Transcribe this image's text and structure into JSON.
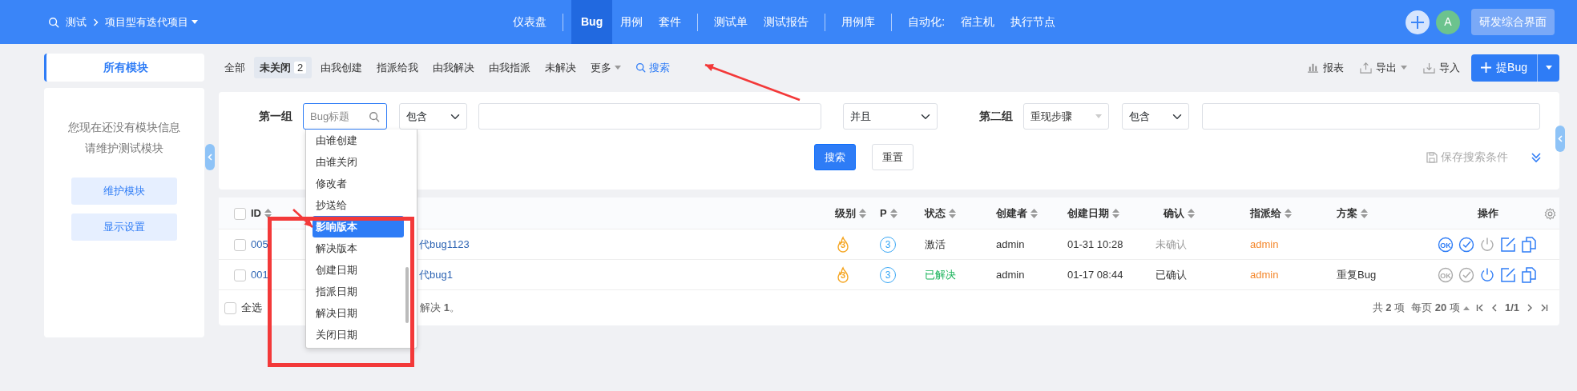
{
  "top_bar": {
    "product": "测试",
    "project": "项目型有迭代项目",
    "nav": [
      [
        {
          "label": "仪表盘",
          "selected": false
        }
      ],
      [
        {
          "label": "Bug",
          "selected": true
        },
        {
          "label": "用例",
          "selected": false
        },
        {
          "label": "套件",
          "selected": false
        }
      ],
      [
        {
          "label": "测试单",
          "selected": false
        },
        {
          "label": "测试报告",
          "selected": false
        }
      ],
      [
        {
          "label": "用例库",
          "selected": false
        }
      ],
      [
        {
          "label": "自动化:",
          "selected": false
        },
        {
          "label": "宿主机",
          "selected": false
        },
        {
          "label": "执行节点",
          "selected": false
        }
      ]
    ],
    "avatar": "A",
    "workspace_button": "研发综合界面"
  },
  "sidebar": {
    "tab": "所有模块",
    "empty_message": [
      "您现在还没有模块信息",
      "请维护测试模块"
    ],
    "buttons": [
      "维护模块",
      "显示设置"
    ]
  },
  "filters": [
    {
      "label": "全部",
      "kind": "tab",
      "selected": false
    },
    {
      "label": "未关闭",
      "count": "2",
      "kind": "tab",
      "selected": true
    },
    {
      "label": "由我创建",
      "kind": "tab",
      "selected": false
    },
    {
      "label": "指派给我",
      "kind": "tab",
      "selected": false
    },
    {
      "label": "由我解决",
      "kind": "tab",
      "selected": false
    },
    {
      "label": "由我指派",
      "kind": "tab",
      "selected": false
    },
    {
      "label": "未解决",
      "kind": "tab",
      "selected": false
    },
    {
      "label": "更多",
      "kind": "menu",
      "selected": false
    },
    {
      "label": "搜索",
      "kind": "search",
      "selected": false
    }
  ],
  "toolbar": [
    {
      "label": "报表",
      "kind": "report"
    },
    {
      "label": "导出",
      "kind": "export"
    },
    {
      "label": "导入",
      "kind": "import"
    }
  ],
  "create_button": "提Bug",
  "search_form": {
    "group_1": {
      "label": "第一组",
      "field_placeholder": "Bug标题",
      "operator": "包含"
    },
    "logic": "并且",
    "group_2": {
      "label": "第二组",
      "field": "重现步骤",
      "operator": "包含"
    },
    "buttons": [
      "搜索",
      "重置"
    ],
    "save_link": "保存搜索条件"
  },
  "field_dropdown": [
    {
      "label": "由谁创建",
      "selected": false
    },
    {
      "label": "由谁关闭",
      "selected": false
    },
    {
      "label": "修改者",
      "selected": false
    },
    {
      "label": "抄送给",
      "selected": false
    },
    {
      "label": "影响版本",
      "selected": true
    },
    {
      "label": "解决版本",
      "selected": false
    },
    {
      "label": "创建日期",
      "selected": false
    },
    {
      "label": "指派日期",
      "selected": false
    },
    {
      "label": "解决日期",
      "selected": false
    },
    {
      "label": "关闭日期",
      "selected": false
    }
  ],
  "table": {
    "header_checked": false,
    "columns": [
      {
        "label": "ID",
        "sortable": true
      },
      {
        "label": "级别",
        "sortable": true
      },
      {
        "label": "P",
        "sortable": true
      },
      {
        "label": "状态",
        "sortable": true
      },
      {
        "label": "创建者",
        "sortable": true
      },
      {
        "label": "创建日期",
        "sortable": true
      },
      {
        "label": "确认",
        "sortable": true
      },
      {
        "label": "指派给",
        "sortable": true
      },
      {
        "label": "方案",
        "sortable": true
      },
      {
        "label": "操作",
        "sortable": false
      }
    ],
    "rows": [
      {
        "checked": false,
        "id": "005",
        "title": "代bug1123",
        "severity": "3",
        "priority": "3",
        "status": {
          "text": "激活",
          "resolved": false
        },
        "creator": "admin",
        "created": "01-31 10:28",
        "confirmation": "未确认",
        "confirmed": false,
        "assigned_to": "admin",
        "actions": [
          {
            "kind": "confirm",
            "label": "OK",
            "disabled": false
          },
          {
            "kind": "resolve",
            "disabled": false
          },
          {
            "kind": "close",
            "disabled": true
          },
          {
            "kind": "edit",
            "disabled": false
          },
          {
            "kind": "copy",
            "disabled": false
          }
        ]
      },
      {
        "checked": false,
        "id": "001",
        "title": "代bug1",
        "severity": "3",
        "priority": "3",
        "status": {
          "text": "已解决",
          "resolved": true
        },
        "creator": "admin",
        "created": "01-17 08:44",
        "confirmation": "已确认",
        "confirmed": true,
        "assigned_to": "admin",
        "resolution": "重复Bug",
        "actions": [
          {
            "kind": "confirm",
            "label": "OK",
            "disabled": true
          },
          {
            "kind": "resolve",
            "disabled": true
          },
          {
            "kind": "close",
            "disabled": false
          },
          {
            "kind": "edit",
            "disabled": false
          },
          {
            "kind": "copy",
            "disabled": false
          }
        ]
      }
    ],
    "footer": {
      "select_all": "全选",
      "select_all_checked": false,
      "summary": "解决 **1**。"
    },
    "pagination": {
      "total": "共 **2** 项",
      "per_page": "每页 **20** 项",
      "page": "1/1"
    }
  },
  "annotations": [
    {
      "kind": "box"
    },
    {
      "kind": "arrow"
    },
    {
      "kind": "arrow"
    }
  ]
}
